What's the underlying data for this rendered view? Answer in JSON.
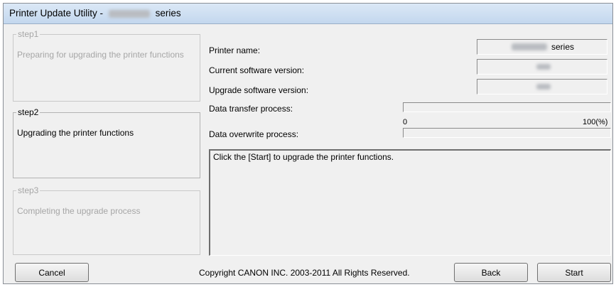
{
  "window": {
    "title_prefix": "Printer Update Utility -",
    "title_suffix": "series"
  },
  "steps": [
    {
      "legend": "step1",
      "description": "Preparing for upgrading the printer functions",
      "state": "disabled"
    },
    {
      "legend": "step2",
      "description": "Upgrading the printer functions",
      "state": "active"
    },
    {
      "legend": "step3",
      "description": "Completing the upgrade process",
      "state": "disabled"
    }
  ],
  "info": {
    "printer_name_label": "Printer name:",
    "printer_name_suffix": "series",
    "current_version_label": "Current software version:",
    "upgrade_version_label": "Upgrade software version:"
  },
  "progress": {
    "transfer_label": "Data transfer process:",
    "overwrite_label": "Data overwrite process:",
    "scale_min": "0",
    "scale_max": "100(%)",
    "transfer_fraction": 0,
    "overwrite_fraction": 0
  },
  "message": "Click the [Start] to upgrade the printer functions.",
  "footer": {
    "cancel_label": "Cancel",
    "copyright": "Copyright CANON INC. 2003-2011 All Rights Reserved.",
    "back_label": "Back",
    "start_label": "Start"
  }
}
